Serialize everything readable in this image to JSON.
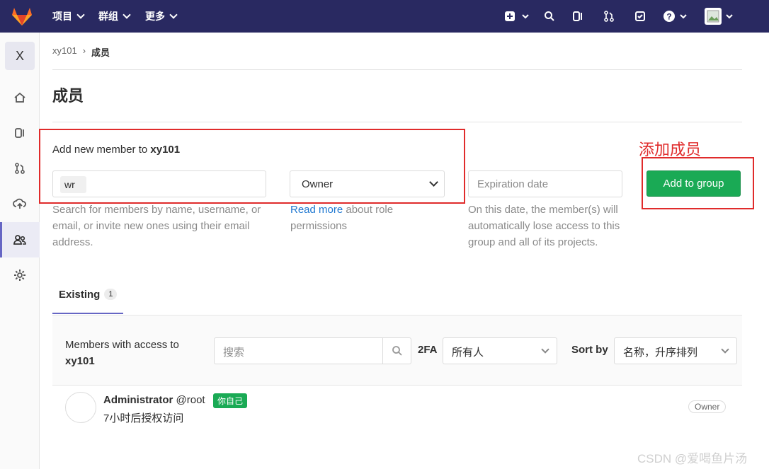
{
  "topbar": {
    "nav": [
      "项目",
      "群组",
      "更多"
    ],
    "icons": [
      "plus-square-icon",
      "search-icon",
      "issues-icon",
      "merge-request-icon",
      "todo-icon",
      "help-icon",
      "avatar-icon"
    ]
  },
  "sidebar": {
    "project_letter": "X",
    "items": [
      "home-icon",
      "issues-icon",
      "merge-request-icon",
      "deploy-icon",
      "members-icon",
      "settings-icon"
    ]
  },
  "breadcrumb": {
    "parent": "xy101",
    "separator": "›",
    "current": "成员"
  },
  "page": {
    "title": "成员"
  },
  "annotation": {
    "label": "添加成员"
  },
  "add_member": {
    "title_prefix": "Add new member to ",
    "group": "xy101",
    "search_value": "wr",
    "search_help": "Search for members by name, username, or email, or invite new ones using their email address.",
    "role_value": "Owner",
    "role_help_link": "Read more",
    "role_help_rest": " about role permissions",
    "expiration_placeholder": "Expiration date",
    "expiration_help": "On this date, the member(s) will automatically lose access to this group and all of its projects.",
    "add_button": "Add to group"
  },
  "tabs": {
    "existing_label": "Existing",
    "existing_count": "1"
  },
  "filter": {
    "label_prefix": "Members with access to",
    "group": "xy101",
    "search_placeholder": "搜索",
    "twofa_label": "2FA",
    "twofa_value": "所有人",
    "sort_label": "Sort by",
    "sort_value": "名称，升序排列"
  },
  "members": [
    {
      "name": "Administrator",
      "username": "@root",
      "badge": "你自己",
      "access": "7小时后授权访问",
      "role": "Owner"
    }
  ],
  "watermark": "CSDN @爱喝鱼片汤",
  "colors": {
    "topbar": "#292961",
    "primary": "#1aaa55",
    "annotation": "#e02b2b",
    "link": "#1f78d1"
  }
}
